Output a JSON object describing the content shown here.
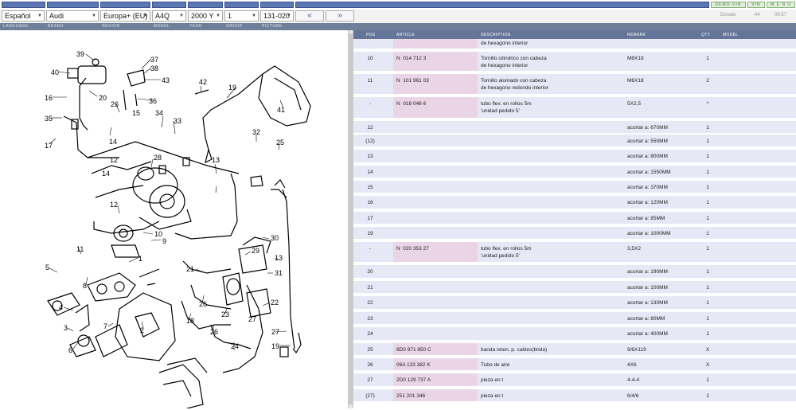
{
  "topbar": {
    "demo_vin": "DEMO-VIN",
    "vin": "VIN",
    "menu": "M E N U"
  },
  "selectors": {
    "language": "Español",
    "brand": "Audi",
    "region": "Europa+ (EU)",
    "model": "A4Q",
    "year": "2000",
    "year_code": "Y",
    "group": "1",
    "picture": "131-020",
    "prev": "«",
    "next": "»",
    "donate": "Donate",
    "count": "-44",
    "clock": "09:57"
  },
  "labels": {
    "language": "LANGUAGE",
    "brand": "BRAND",
    "region": "REGION",
    "model": "MODEL",
    "year": "YEAR",
    "group": "GROUP",
    "picture": "PICTURE"
  },
  "table": {
    "headers": {
      "pos": "POS",
      "article": "ARTICLE",
      "description": "DESCRIPTION",
      "remark": "REMARK",
      "qty": "QTY",
      "model": "MODEL"
    },
    "rows": [
      {
        "pos": "",
        "article": "",
        "description": "de hexagono interior",
        "remark": "",
        "qty": ""
      },
      {
        "pos": "10",
        "article": "N  014 712 3",
        "description": "Tornillo cilindrico con cabeza\nde hexagono interior",
        "remark": "M8X18",
        "qty": "1"
      },
      {
        "pos": "11",
        "article": "N  101 961 03",
        "description": "Tornillo alomado con cabeza\nde hexagono redondo interior",
        "remark": "M6X18",
        "qty": "2"
      },
      {
        "pos": "-",
        "article": "N  018 046 6",
        "description": "tubo flex. en rollos 5m\n'unidad pedido 5'",
        "remark": "5X2,5",
        "qty": "*"
      },
      {
        "pos": "12",
        "article": "",
        "description": "",
        "remark": "acortar a: 670MM",
        "qty": "1"
      },
      {
        "pos": "(12)",
        "article": "",
        "description": "",
        "remark": "acortar a: 550MM",
        "qty": "1"
      },
      {
        "pos": "13",
        "article": "",
        "description": "",
        "remark": "acortar a: 800MM",
        "qty": "1"
      },
      {
        "pos": "14",
        "article": "",
        "description": "",
        "remark": "acortar a: 1550MM",
        "qty": "1"
      },
      {
        "pos": "15",
        "article": "",
        "description": "",
        "remark": "acortar a: 370MM",
        "qty": "1"
      },
      {
        "pos": "16",
        "article": "",
        "description": "",
        "remark": "acortar a: 120MM",
        "qty": "1"
      },
      {
        "pos": "17",
        "article": "",
        "description": "",
        "remark": "acortar a: 85MM",
        "qty": "1"
      },
      {
        "pos": "19",
        "article": "",
        "description": "",
        "remark": "acortar a: 1000MM",
        "qty": "1"
      },
      {
        "pos": "-",
        "article": "N  020 353 27",
        "description": "tubo flex. en rollos 5m\n'unidad pedido 5'",
        "remark": "3,5X2",
        "qty": "1"
      },
      {
        "pos": "20",
        "article": "",
        "description": "",
        "remark": "acortar a: 190MM",
        "qty": "1"
      },
      {
        "pos": "21",
        "article": "",
        "description": "",
        "remark": "acortar a: 100MM",
        "qty": "1"
      },
      {
        "pos": "22",
        "article": "",
        "description": "",
        "remark": "acortar a: 130MM",
        "qty": "1"
      },
      {
        "pos": "23",
        "article": "",
        "description": "",
        "remark": "acortar a: 80MM",
        "qty": "1"
      },
      {
        "pos": "24",
        "article": "",
        "description": "",
        "remark": "acortar a: 400MM",
        "qty": "1"
      },
      {
        "pos": "25",
        "article": "8D0 971 850 C",
        "description": "banda reten. p. cables(brida)",
        "remark": "9/6X119",
        "qty": "X"
      },
      {
        "pos": "26",
        "article": "06A 133 382 K",
        "description": "Tubo de aire",
        "remark": "4X6",
        "qty": "X"
      },
      {
        "pos": "27",
        "article": "2D0 129 737 A",
        "description": "pieza en t",
        "remark": "4-4-4",
        "qty": "1"
      },
      {
        "pos": "(27)",
        "article": "251 201 346",
        "description": "pieza en t",
        "remark": "6/4/6",
        "qty": "1"
      }
    ]
  },
  "diagram": {
    "callouts": [
      "39",
      "37",
      "38",
      "43",
      "40",
      "20",
      "16",
      "26",
      "15",
      "36",
      "34",
      "33",
      "35",
      "14",
      "17",
      "28",
      "12",
      "13",
      "42",
      "19",
      "41",
      "32",
      "25",
      "12",
      "10",
      "9",
      "11",
      "8",
      "1",
      "5",
      "3",
      "4",
      "6",
      "7",
      "2",
      "30",
      "29",
      "31",
      "21",
      "22",
      "26",
      "18",
      "23",
      "27",
      "24",
      "26",
      "13",
      "27",
      "19",
      "14"
    ]
  }
}
